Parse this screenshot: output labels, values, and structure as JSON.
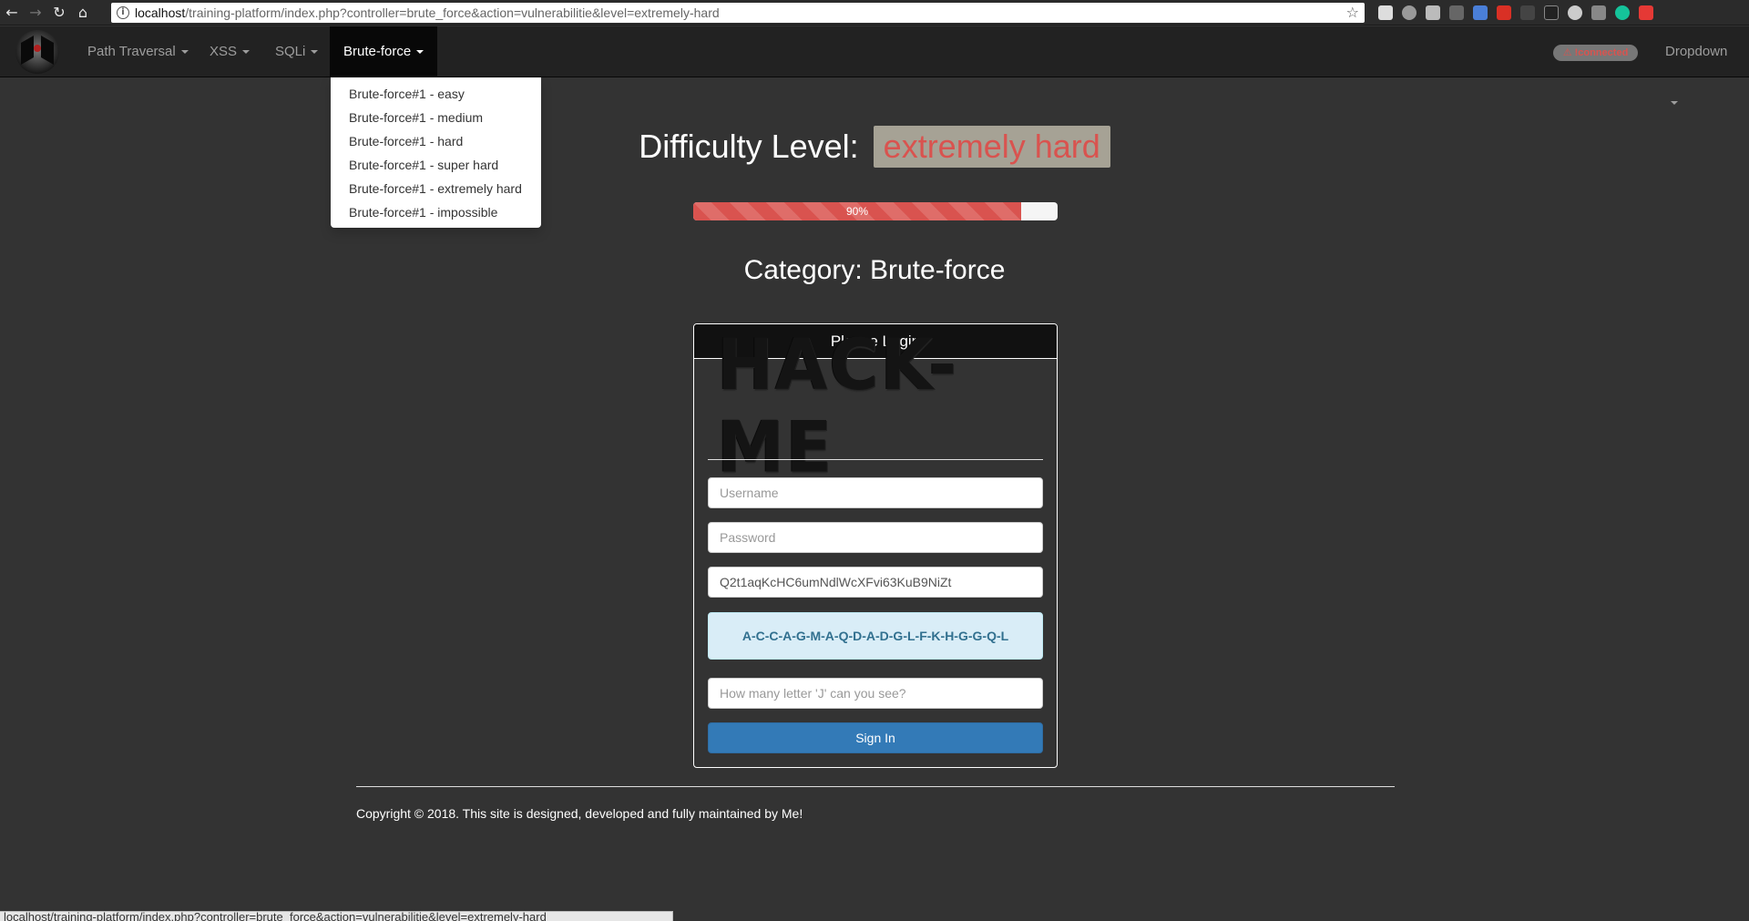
{
  "browser": {
    "url_host": "localhost",
    "url_path": "/training-platform/index.php?controller=brute_force&action=vulnerabilitie&level=extremely-hard",
    "status_url": "localhost/training-platform/index.php?controller=brute_force&action=vulnerabilitie&level=extremely-hard"
  },
  "navbar": {
    "items": [
      {
        "label": "Path Traversal"
      },
      {
        "label": "XSS"
      },
      {
        "label": "SQLi"
      },
      {
        "label": "Brute-force"
      }
    ],
    "connection_badge": "⚠ !connected",
    "right_dropdown": "Dropdown"
  },
  "dropdown": {
    "items": [
      "Brute-force#1 - easy",
      "Brute-force#1 - medium",
      "Brute-force#1 - hard",
      "Brute-force#1 - super hard",
      "Brute-force#1 - extremely hard",
      "Brute-force#1 - impossible"
    ]
  },
  "main": {
    "difficulty_prefix": "Difficulty Level:",
    "difficulty_value": "extremely hard",
    "progress_label": "90%",
    "progress_value": 0.9,
    "category": "Category: Brute-force"
  },
  "login": {
    "heading": "Please Login",
    "logo_text": "HACK-ME",
    "username_placeholder": "Username",
    "password_placeholder": "Password",
    "token_value": "Q2t1aqKcHC6umNdlWcXFvi63KuB9NiZt",
    "captcha": "A-C-C-A-G-M-A-Q-D-A-D-G-L-F-K-H-G-G-Q-L",
    "question_placeholder": "How many letter 'J' can you see?",
    "signin_label": "Sign In"
  },
  "footer": {
    "text": "Copyright © 2018. This site is designed, developed and fully maintained by Me!"
  },
  "colors": {
    "navbar_bg": "#222222",
    "page_bg": "#333333",
    "danger": "#d9534f",
    "primary": "#337ab7",
    "info_bg": "#d9edf7"
  }
}
